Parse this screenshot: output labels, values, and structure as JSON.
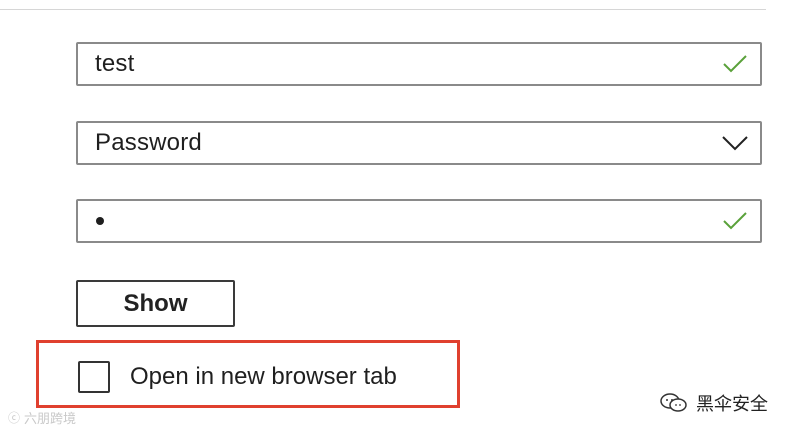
{
  "form": {
    "username_value": "test",
    "auth_type_selected": "Password",
    "password_value": "•",
    "show_button_label": "Show",
    "open_new_tab_label": "Open in new browser tab",
    "open_new_tab_checked": false
  },
  "icons": {
    "username_status": "check-icon",
    "password_status": "check-icon",
    "select_chevron": "chevron-down-icon"
  },
  "colors": {
    "check": "#5aa13a",
    "highlight": "#e0402f",
    "border": "#8a8a8a"
  },
  "watermarks": {
    "left_text": "六朋跨境",
    "right_text": "黑伞安全"
  }
}
